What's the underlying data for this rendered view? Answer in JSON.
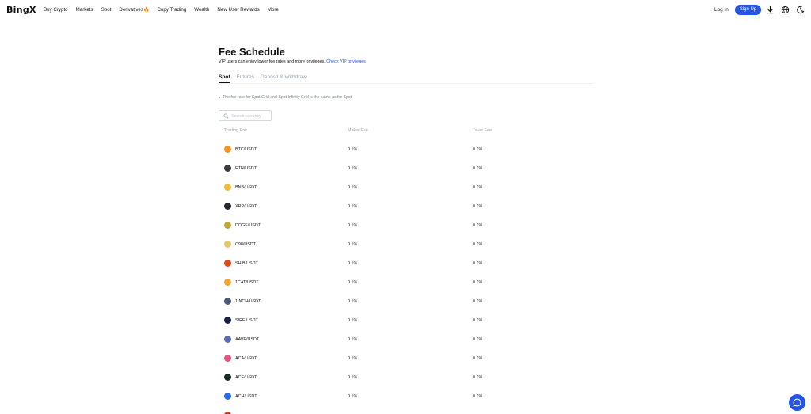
{
  "header": {
    "logo": "BingX",
    "nav": [
      {
        "label": "Buy Crypto"
      },
      {
        "label": "Markets"
      },
      {
        "label": "Spot"
      },
      {
        "label": "Derivatives"
      },
      {
        "label": "Copy Trading"
      },
      {
        "label": "Wealth"
      },
      {
        "label": "New User Rewards"
      },
      {
        "label": "More"
      }
    ],
    "login": "Log In",
    "signup": "Sign Up"
  },
  "page": {
    "title": "Fee Schedule",
    "subtitle": "VIP users can enjoy lower fee rates and more privileges.",
    "subtitle_link": "Check VIP privileges",
    "tabs": [
      {
        "label": "Spot",
        "active": true
      },
      {
        "label": "Futures",
        "active": false
      },
      {
        "label": "Deposit & Withdraw",
        "active": false
      }
    ],
    "note": "The fee rate for Spot Grid and Spot Infinity Grid is the same as for Spot",
    "search_placeholder": "Search currency"
  },
  "table": {
    "headers": {
      "pair": "Trading Pair",
      "maker": "Maker Fee",
      "taker": "Taker Fee"
    },
    "rows": [
      {
        "pair": "BTC/USDT",
        "maker": "0.1%",
        "taker": "0.1%",
        "icon": "btc-icon",
        "color": "#f7931a"
      },
      {
        "pair": "ETH/USDT",
        "maker": "0.1%",
        "taker": "0.1%",
        "icon": "eth-icon",
        "color": "#3c3c3d"
      },
      {
        "pair": "BNB/USDT",
        "maker": "0.1%",
        "taker": "0.1%",
        "icon": "bnb-icon",
        "color": "#f3ba2f"
      },
      {
        "pair": "XRP/USDT",
        "maker": "0.1%",
        "taker": "0.1%",
        "icon": "xrp-icon",
        "color": "#23292f"
      },
      {
        "pair": "DOGE/USDT",
        "maker": "0.1%",
        "taker": "0.1%",
        "icon": "doge-icon",
        "color": "#c2a633"
      },
      {
        "pair": "C98/USDT",
        "maker": "0.1%",
        "taker": "0.1%",
        "icon": "c98-icon",
        "color": "#e5c76b"
      },
      {
        "pair": "SHIB/USDT",
        "maker": "0.1%",
        "taker": "0.1%",
        "icon": "shib-icon",
        "color": "#e44b1b"
      },
      {
        "pair": "1CAT/USDT",
        "maker": "0.1%",
        "taker": "0.1%",
        "icon": "1cat-icon",
        "color": "#f4a62a"
      },
      {
        "pair": "1INCH/USDT",
        "maker": "0.1%",
        "taker": "0.1%",
        "icon": "1inch-icon",
        "color": "#4a5a7a"
      },
      {
        "pair": "SIRE/USDT",
        "maker": "0.1%",
        "taker": "0.1%",
        "icon": "sire-icon",
        "color": "#1c1f4a"
      },
      {
        "pair": "AAVE/USDT",
        "maker": "0.1%",
        "taker": "0.1%",
        "icon": "aave-icon",
        "color": "#5b6cb8"
      },
      {
        "pair": "ACA/USDT",
        "maker": "0.1%",
        "taker": "0.1%",
        "icon": "aca-icon",
        "color": "#e8537d"
      },
      {
        "pair": "ACE/USDT",
        "maker": "0.1%",
        "taker": "0.1%",
        "icon": "ace-icon",
        "color": "#1a2a2a"
      },
      {
        "pair": "ACH/USDT",
        "maker": "0.1%",
        "taker": "0.1%",
        "icon": "ach-icon",
        "color": "#2b6de8"
      }
    ]
  },
  "colors": {
    "accent": "#2354e6",
    "text": "#121214",
    "muted": "#9aa0ab"
  }
}
